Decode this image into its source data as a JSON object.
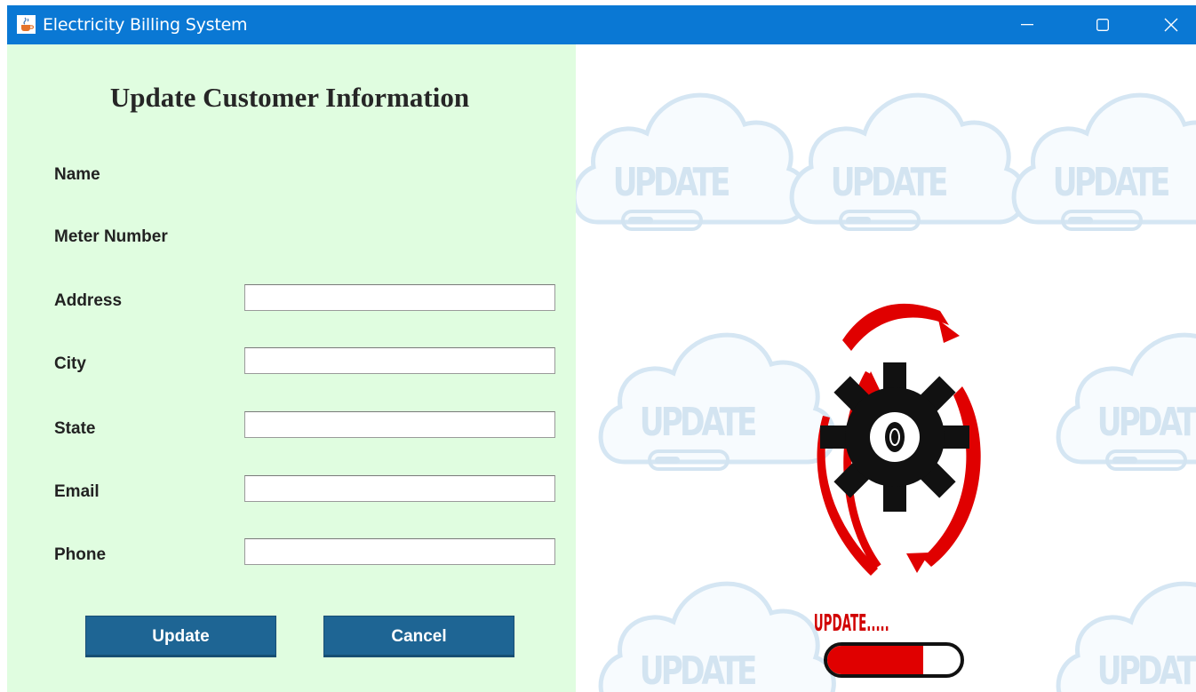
{
  "window": {
    "title": "Electricity Billing System",
    "icon": "java-cup-icon"
  },
  "form": {
    "heading": "Update Customer Information",
    "labels": {
      "name": "Name",
      "meter_number": "Meter Number",
      "address": "Address",
      "city": "City",
      "state": "State",
      "email": "Email",
      "phone": "Phone"
    },
    "values": {
      "name": "",
      "meter_number": "",
      "address": "",
      "city": "",
      "state": "",
      "email": "",
      "phone": ""
    },
    "buttons": {
      "update": "Update",
      "cancel": "Cancel"
    }
  },
  "illustration": {
    "background_pattern_text": "UPDATE",
    "caption": "UPDATE.....",
    "progress": 0.72,
    "colors": {
      "arrows": "#e00000",
      "gear": "#111111",
      "pattern": "#c9deef"
    }
  },
  "colors": {
    "titlebar": "#0a78d4",
    "form_background": "#e0fde0",
    "button": "#1e6594"
  }
}
